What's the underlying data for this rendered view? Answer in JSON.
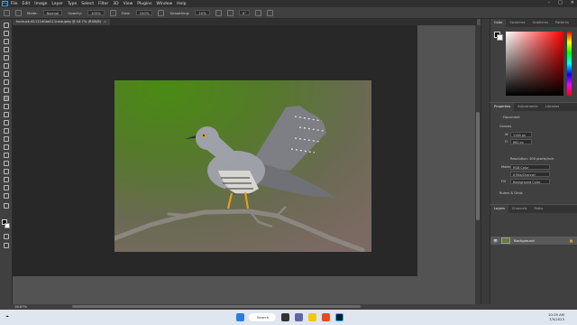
{
  "menubar": {
    "logo": "Ps",
    "items": [
      "File",
      "Edit",
      "Image",
      "Layer",
      "Type",
      "Select",
      "Filter",
      "3D",
      "View",
      "Plugins",
      "Window",
      "Help"
    ]
  },
  "options": {
    "mode_label": "Mode:",
    "mode_value": "Normal",
    "opacity_label": "Opacity:",
    "opacity_value": "100%",
    "flow_label": "Flow:",
    "flow_value": "100%",
    "smoothing_label": "Smoothing:",
    "smoothing_value": "10%",
    "angle_value": "0°"
  },
  "document": {
    "tab_title": "kuckuck-61121d0ae211new.jpeg @ 16.7% (RGB/8)",
    "close": "×",
    "zoom": "16.67%"
  },
  "color_panel": {
    "tabs": [
      "Color",
      "Swatches",
      "Gradients",
      "Patterns"
    ]
  },
  "properties_panel": {
    "tabs": [
      "Properties",
      "Adjustments",
      "Libraries"
    ],
    "document_label": "Document",
    "canvas_section": "Canvas",
    "width_label": "W",
    "width_value": "1146 px",
    "height_label": "H",
    "height_value": "662 px",
    "resolution_text": "Resolution: 300 pixels/inch",
    "mode_label": "Mode",
    "mode_value": "RGB Color",
    "depth_value": "8 Bits/Channel",
    "fill_label": "Fill",
    "fill_value": "Background Color",
    "rulers_section": "Rulers & Grids"
  },
  "layers_panel": {
    "tabs": [
      "Layers",
      "Channels",
      "Paths"
    ],
    "layer_name": "Background"
  },
  "taskbar": {
    "search_label": "Search",
    "time": "10:29 AM",
    "date": "7/5/2023"
  }
}
